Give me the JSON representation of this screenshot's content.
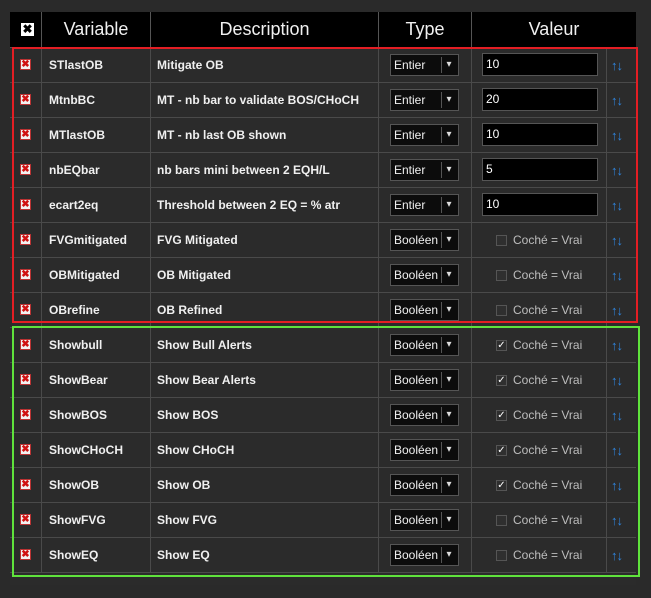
{
  "header": {
    "close_glyph": "✖",
    "col_variable": "Variable",
    "col_description": "Description",
    "col_type": "Type",
    "col_valeur": "Valeur"
  },
  "rows": [
    {
      "name": "STlastOB",
      "description": "Mitigate OB",
      "type": "Entier",
      "value": "10"
    },
    {
      "name": "MtnbBC",
      "description": "MT - nb bar to validate BOS/CHoCH",
      "type": "Entier",
      "value": "20"
    },
    {
      "name": "MTlastOB",
      "description": "MT - nb last OB shown",
      "type": "Entier",
      "value": "10"
    },
    {
      "name": "nbEQbar",
      "description": "nb bars mini between 2 EQH/L",
      "type": "Entier",
      "value": "5"
    },
    {
      "name": "ecart2eq",
      "description": "Threshold between 2 EQ = % atr",
      "type": "Entier",
      "value": "10"
    },
    {
      "name": "FVGmitigated",
      "description": "FVG Mitigated",
      "type": "Booléen",
      "checked": false,
      "check_label": "Coché = Vrai"
    },
    {
      "name": "OBMitigated",
      "description": "OB Mitigated",
      "type": "Booléen",
      "checked": false,
      "check_label": "Coché = Vrai"
    },
    {
      "name": "OBrefine",
      "description": "OB Refined",
      "type": "Booléen",
      "checked": false,
      "check_label": "Coché = Vrai"
    },
    {
      "name": "Showbull",
      "description": "Show Bull Alerts",
      "type": "Booléen",
      "checked": true,
      "check_label": "Coché = Vrai"
    },
    {
      "name": "ShowBear",
      "description": "Show Bear Alerts",
      "type": "Booléen",
      "checked": true,
      "check_label": "Coché = Vrai"
    },
    {
      "name": "ShowBOS",
      "description": "Show BOS",
      "type": "Booléen",
      "checked": true,
      "check_label": "Coché = Vrai"
    },
    {
      "name": "ShowCHoCH",
      "description": "Show CHoCH",
      "type": "Booléen",
      "checked": true,
      "check_label": "Coché = Vrai"
    },
    {
      "name": "ShowOB",
      "description": "Show OB",
      "type": "Booléen",
      "checked": true,
      "check_label": "Coché = Vrai"
    },
    {
      "name": "ShowFVG",
      "description": "Show FVG",
      "type": "Booléen",
      "checked": false,
      "check_label": "Coché = Vrai"
    },
    {
      "name": "ShowEQ",
      "description": "Show EQ",
      "type": "Booléen",
      "checked": false,
      "check_label": "Coché = Vrai"
    }
  ],
  "icons": {
    "delete": "✖",
    "chevron": "▾",
    "check": "✓",
    "move_up": "↑",
    "move_down": "↓"
  },
  "colors": {
    "highlight_red": "#e31e24",
    "highlight_green": "#5fe23c",
    "arrow_blue": "#2f86e0"
  }
}
